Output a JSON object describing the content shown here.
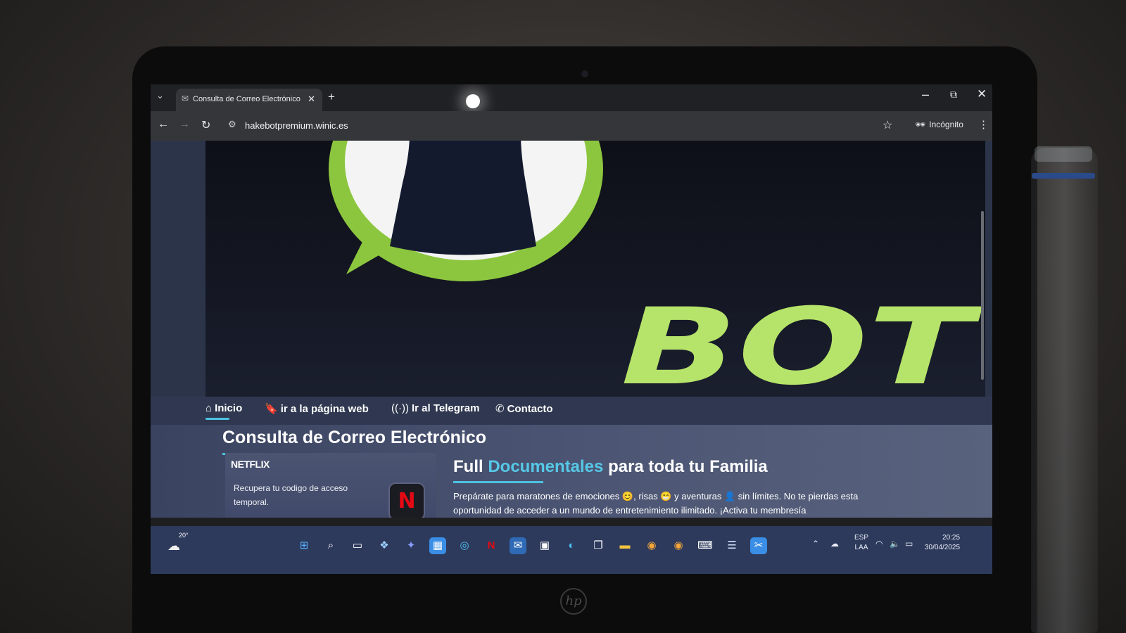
{
  "browser": {
    "tab_title": "Consulta de Correo Electrónico",
    "new_tab": "+",
    "url": "hakebotpremium.winic.es",
    "incognito_label": "Incógnito"
  },
  "hero": {
    "logo_text": "BOT",
    "colors": {
      "brand_green": "#8cc63f",
      "lime": "#b6e36a",
      "dark": "#141a2e"
    }
  },
  "nav": {
    "items": [
      {
        "label": "Inicio",
        "icon": "home-icon"
      },
      {
        "label": "ir a la página web",
        "icon": "bookmark-icon"
      },
      {
        "label": "Ir al Telegram",
        "icon": "broadcast-icon"
      },
      {
        "label": "Contacto",
        "icon": "whatsapp-icon"
      }
    ],
    "active_index": 0
  },
  "main": {
    "heading": "Consulta de Correo Electrónico",
    "card": {
      "title": "NETFLIX",
      "text": "Recupera tu codigo de acceso temporal.",
      "icon_letter": "N"
    },
    "promo": {
      "title_pre": "Full",
      "title_accent": "Documentales",
      "title_post": "para toda tu Familia",
      "text": "Prepárate para maratones de emociones 😊, risas 😁 y aventuras 👤 sin límites. No te pierdas esta oportunidad de acceder a un mundo de entretenimiento ilimitado. ¡Activa tu membresía"
    }
  },
  "taskbar": {
    "weather_temp": "20°",
    "lang_line1": "ESP",
    "lang_line2": "LAA",
    "time": "20:25",
    "date": "30/04/2025"
  }
}
